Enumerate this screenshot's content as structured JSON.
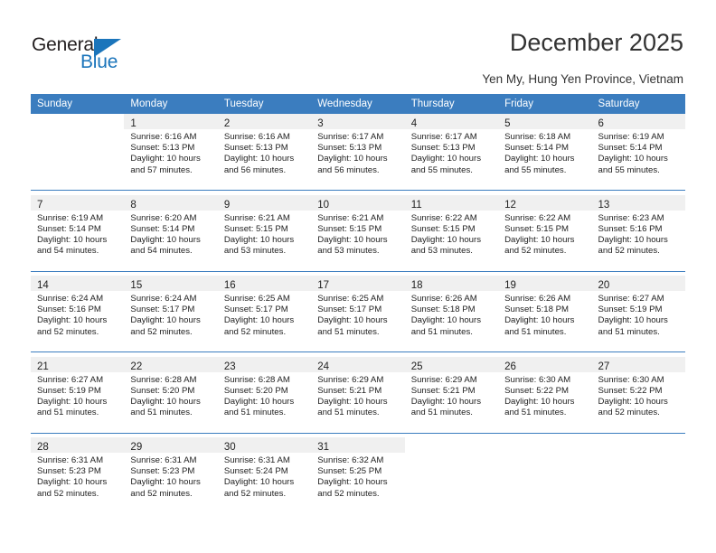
{
  "brand": {
    "name_top": "General",
    "name_bottom": "Blue",
    "triangle_icon": "triangle-icon",
    "color_dark": "#231f20",
    "color_blue": "#1b75bb"
  },
  "header": {
    "title": "December 2025",
    "subtitle": "Yen My, Hung Yen Province, Vietnam"
  },
  "calendar": {
    "accent_color": "#3b7dbf",
    "weekday_headers": [
      "Sunday",
      "Monday",
      "Tuesday",
      "Wednesday",
      "Thursday",
      "Friday",
      "Saturday"
    ],
    "weeks": [
      [
        {
          "day": "",
          "lines": []
        },
        {
          "day": "1",
          "lines": [
            "Sunrise: 6:16 AM",
            "Sunset: 5:13 PM",
            "Daylight: 10 hours",
            "and 57 minutes."
          ]
        },
        {
          "day": "2",
          "lines": [
            "Sunrise: 6:16 AM",
            "Sunset: 5:13 PM",
            "Daylight: 10 hours",
            "and 56 minutes."
          ]
        },
        {
          "day": "3",
          "lines": [
            "Sunrise: 6:17 AM",
            "Sunset: 5:13 PM",
            "Daylight: 10 hours",
            "and 56 minutes."
          ]
        },
        {
          "day": "4",
          "lines": [
            "Sunrise: 6:17 AM",
            "Sunset: 5:13 PM",
            "Daylight: 10 hours",
            "and 55 minutes."
          ]
        },
        {
          "day": "5",
          "lines": [
            "Sunrise: 6:18 AM",
            "Sunset: 5:14 PM",
            "Daylight: 10 hours",
            "and 55 minutes."
          ]
        },
        {
          "day": "6",
          "lines": [
            "Sunrise: 6:19 AM",
            "Sunset: 5:14 PM",
            "Daylight: 10 hours",
            "and 55 minutes."
          ]
        }
      ],
      [
        {
          "day": "7",
          "lines": [
            "Sunrise: 6:19 AM",
            "Sunset: 5:14 PM",
            "Daylight: 10 hours",
            "and 54 minutes."
          ]
        },
        {
          "day": "8",
          "lines": [
            "Sunrise: 6:20 AM",
            "Sunset: 5:14 PM",
            "Daylight: 10 hours",
            "and 54 minutes."
          ]
        },
        {
          "day": "9",
          "lines": [
            "Sunrise: 6:21 AM",
            "Sunset: 5:15 PM",
            "Daylight: 10 hours",
            "and 53 minutes."
          ]
        },
        {
          "day": "10",
          "lines": [
            "Sunrise: 6:21 AM",
            "Sunset: 5:15 PM",
            "Daylight: 10 hours",
            "and 53 minutes."
          ]
        },
        {
          "day": "11",
          "lines": [
            "Sunrise: 6:22 AM",
            "Sunset: 5:15 PM",
            "Daylight: 10 hours",
            "and 53 minutes."
          ]
        },
        {
          "day": "12",
          "lines": [
            "Sunrise: 6:22 AM",
            "Sunset: 5:15 PM",
            "Daylight: 10 hours",
            "and 52 minutes."
          ]
        },
        {
          "day": "13",
          "lines": [
            "Sunrise: 6:23 AM",
            "Sunset: 5:16 PM",
            "Daylight: 10 hours",
            "and 52 minutes."
          ]
        }
      ],
      [
        {
          "day": "14",
          "lines": [
            "Sunrise: 6:24 AM",
            "Sunset: 5:16 PM",
            "Daylight: 10 hours",
            "and 52 minutes."
          ]
        },
        {
          "day": "15",
          "lines": [
            "Sunrise: 6:24 AM",
            "Sunset: 5:17 PM",
            "Daylight: 10 hours",
            "and 52 minutes."
          ]
        },
        {
          "day": "16",
          "lines": [
            "Sunrise: 6:25 AM",
            "Sunset: 5:17 PM",
            "Daylight: 10 hours",
            "and 52 minutes."
          ]
        },
        {
          "day": "17",
          "lines": [
            "Sunrise: 6:25 AM",
            "Sunset: 5:17 PM",
            "Daylight: 10 hours",
            "and 51 minutes."
          ]
        },
        {
          "day": "18",
          "lines": [
            "Sunrise: 6:26 AM",
            "Sunset: 5:18 PM",
            "Daylight: 10 hours",
            "and 51 minutes."
          ]
        },
        {
          "day": "19",
          "lines": [
            "Sunrise: 6:26 AM",
            "Sunset: 5:18 PM",
            "Daylight: 10 hours",
            "and 51 minutes."
          ]
        },
        {
          "day": "20",
          "lines": [
            "Sunrise: 6:27 AM",
            "Sunset: 5:19 PM",
            "Daylight: 10 hours",
            "and 51 minutes."
          ]
        }
      ],
      [
        {
          "day": "21",
          "lines": [
            "Sunrise: 6:27 AM",
            "Sunset: 5:19 PM",
            "Daylight: 10 hours",
            "and 51 minutes."
          ]
        },
        {
          "day": "22",
          "lines": [
            "Sunrise: 6:28 AM",
            "Sunset: 5:20 PM",
            "Daylight: 10 hours",
            "and 51 minutes."
          ]
        },
        {
          "day": "23",
          "lines": [
            "Sunrise: 6:28 AM",
            "Sunset: 5:20 PM",
            "Daylight: 10 hours",
            "and 51 minutes."
          ]
        },
        {
          "day": "24",
          "lines": [
            "Sunrise: 6:29 AM",
            "Sunset: 5:21 PM",
            "Daylight: 10 hours",
            "and 51 minutes."
          ]
        },
        {
          "day": "25",
          "lines": [
            "Sunrise: 6:29 AM",
            "Sunset: 5:21 PM",
            "Daylight: 10 hours",
            "and 51 minutes."
          ]
        },
        {
          "day": "26",
          "lines": [
            "Sunrise: 6:30 AM",
            "Sunset: 5:22 PM",
            "Daylight: 10 hours",
            "and 51 minutes."
          ]
        },
        {
          "day": "27",
          "lines": [
            "Sunrise: 6:30 AM",
            "Sunset: 5:22 PM",
            "Daylight: 10 hours",
            "and 52 minutes."
          ]
        }
      ],
      [
        {
          "day": "28",
          "lines": [
            "Sunrise: 6:31 AM",
            "Sunset: 5:23 PM",
            "Daylight: 10 hours",
            "and 52 minutes."
          ]
        },
        {
          "day": "29",
          "lines": [
            "Sunrise: 6:31 AM",
            "Sunset: 5:23 PM",
            "Daylight: 10 hours",
            "and 52 minutes."
          ]
        },
        {
          "day": "30",
          "lines": [
            "Sunrise: 6:31 AM",
            "Sunset: 5:24 PM",
            "Daylight: 10 hours",
            "and 52 minutes."
          ]
        },
        {
          "day": "31",
          "lines": [
            "Sunrise: 6:32 AM",
            "Sunset: 5:25 PM",
            "Daylight: 10 hours",
            "and 52 minutes."
          ]
        },
        {
          "day": "",
          "lines": []
        },
        {
          "day": "",
          "lines": []
        },
        {
          "day": "",
          "lines": []
        }
      ]
    ]
  }
}
